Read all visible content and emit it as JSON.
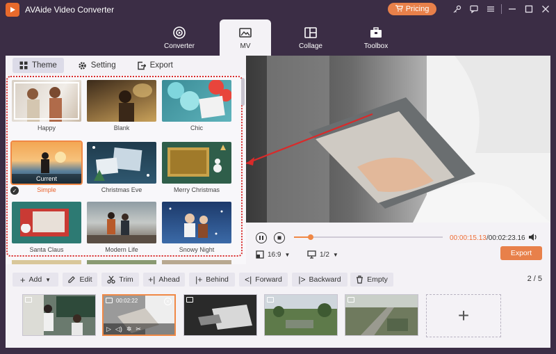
{
  "app": {
    "title": "AVAide Video Converter",
    "pricing_label": "Pricing"
  },
  "nav": [
    {
      "label": "Converter",
      "icon": "converter-icon"
    },
    {
      "label": "MV",
      "icon": "mv-icon"
    },
    {
      "label": "Collage",
      "icon": "collage-icon"
    },
    {
      "label": "Toolbox",
      "icon": "toolbox-icon"
    }
  ],
  "subtabs": [
    {
      "label": "Theme",
      "icon": "theme-grid-icon"
    },
    {
      "label": "Setting",
      "icon": "gear-icon"
    },
    {
      "label": "Export",
      "icon": "export-icon"
    }
  ],
  "themes": [
    {
      "label": "Happy"
    },
    {
      "label": "Blank"
    },
    {
      "label": "Chic"
    },
    {
      "label": "Simple",
      "tag": "Current"
    },
    {
      "label": "Christmas Eve"
    },
    {
      "label": "Merry Christmas"
    },
    {
      "label": "Santa Claus"
    },
    {
      "label": "Modern Life"
    },
    {
      "label": "Snowy Night"
    }
  ],
  "player": {
    "time_current": "00:00:15.13",
    "time_total": "/00:02:23.16",
    "progress": 0.11,
    "ratio": "16:9",
    "page": "1/2",
    "export_label": "Export"
  },
  "toolbar": {
    "add": "Add",
    "edit": "Edit",
    "trim": "Trim",
    "ahead": "Ahead",
    "behind": "Behind",
    "forward": "Forward",
    "backward": "Backward",
    "empty": "Empty",
    "page_current": "2",
    "page_total": "5"
  },
  "clips": [
    {
      "time": ""
    },
    {
      "time": "00:02:22"
    },
    {
      "time": ""
    },
    {
      "time": ""
    },
    {
      "time": ""
    }
  ],
  "colors": {
    "accent": "#e8804a",
    "background": "#3b2d45",
    "panel": "#f4f2f6"
  }
}
